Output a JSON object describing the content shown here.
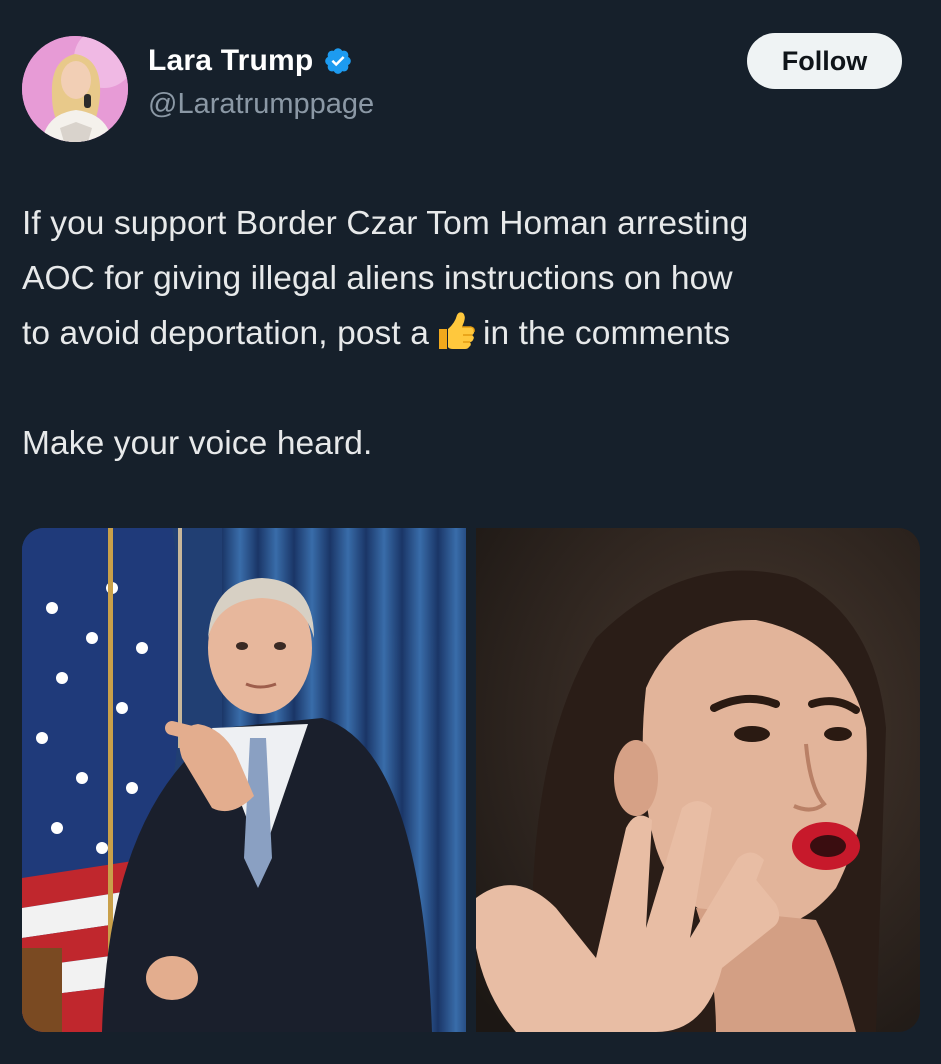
{
  "post": {
    "author": {
      "display_name": "Lara Trump",
      "handle": "@Laratrumppage",
      "verified": true,
      "avatar_icon": "profile-photo"
    },
    "follow_label": "Follow",
    "text": {
      "line1": "If you support Border Czar Tom Homan arresting",
      "line2": "AOC for giving illegal aliens instructions on how",
      "line3_before": "to avoid deportation, post a",
      "line3_emoji": "thumbs-up-icon",
      "line3_after": "in the comments",
      "line4": "Make your voice heard."
    },
    "media": [
      {
        "icon": "photo-man-at-podium-with-flag"
      },
      {
        "icon": "photo-woman-speaking"
      }
    ]
  },
  "colors": {
    "background": "#16202b",
    "text": "#e7e9ea",
    "secondary_text": "#8b98a5",
    "verified_blue": "#1d9bf0",
    "follow_bg": "#eff3f4"
  }
}
